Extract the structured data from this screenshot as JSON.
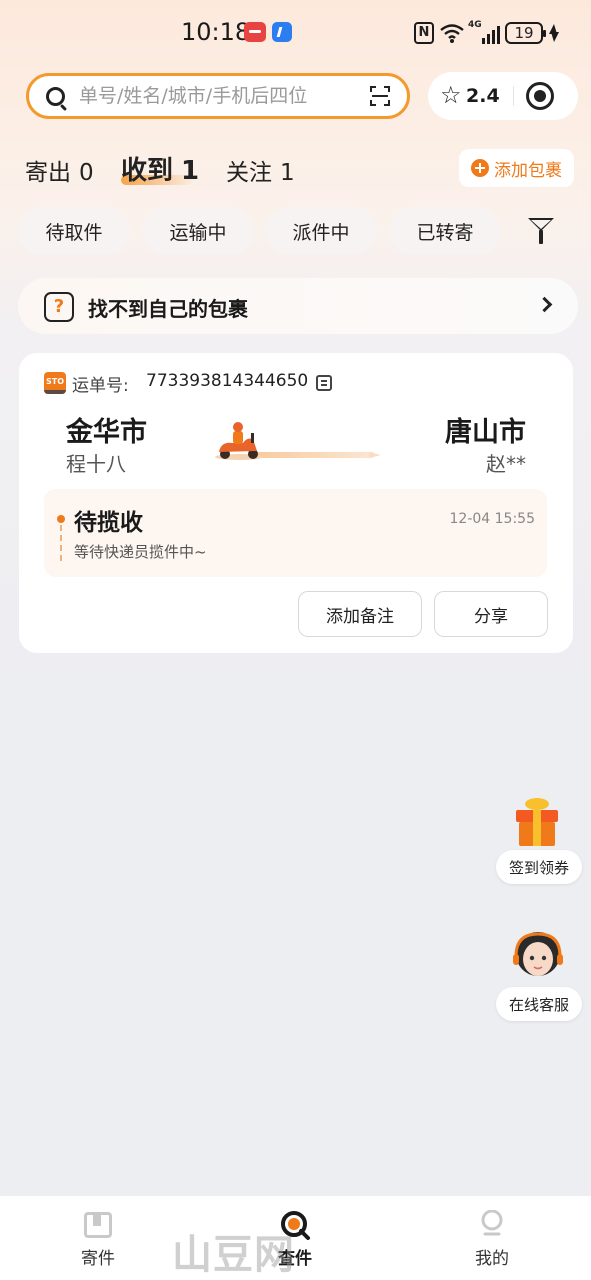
{
  "status_bar": {
    "time": "10:18",
    "network_type": "4G",
    "battery": "19"
  },
  "search": {
    "placeholder": "单号/姓名/城市/手机后四位",
    "value": ""
  },
  "rating": {
    "value": "2.4"
  },
  "tabs": [
    {
      "label": "寄出",
      "count": "0"
    },
    {
      "label": "收到",
      "count": "1",
      "active": true
    },
    {
      "label": "关注",
      "count": "1"
    }
  ],
  "add_package_label": "添加包裹",
  "filters": [
    "待取件",
    "运输中",
    "派件中",
    "已转寄"
  ],
  "help_banner": {
    "text": "找不到自己的包裹",
    "icon_char": "?"
  },
  "package": {
    "carrier_logo_text": "STO",
    "tracking_label": "运单号:",
    "tracking_number": "773393814344650",
    "origin_city": "金华市",
    "origin_name": "程十八",
    "dest_city": "唐山市",
    "dest_name": "赵**",
    "status_title": "待揽收",
    "status_time": "12-04 15:55",
    "status_desc": "等待快递员揽件中~",
    "actions": [
      "添加备注",
      "分享"
    ]
  },
  "floating": {
    "checkin_label": "签到领券",
    "support_label": "在线客服"
  },
  "bottom_nav": [
    {
      "label": "寄件",
      "icon": "box-icon"
    },
    {
      "label": "查件",
      "icon": "query-icon",
      "active": true
    },
    {
      "label": "我的",
      "icon": "profile-icon"
    }
  ],
  "watermark": "山豆网 Shandon.net",
  "colors": {
    "accent": "#f07a1a",
    "search_border": "#f39a2e",
    "background": "#edeef2"
  }
}
